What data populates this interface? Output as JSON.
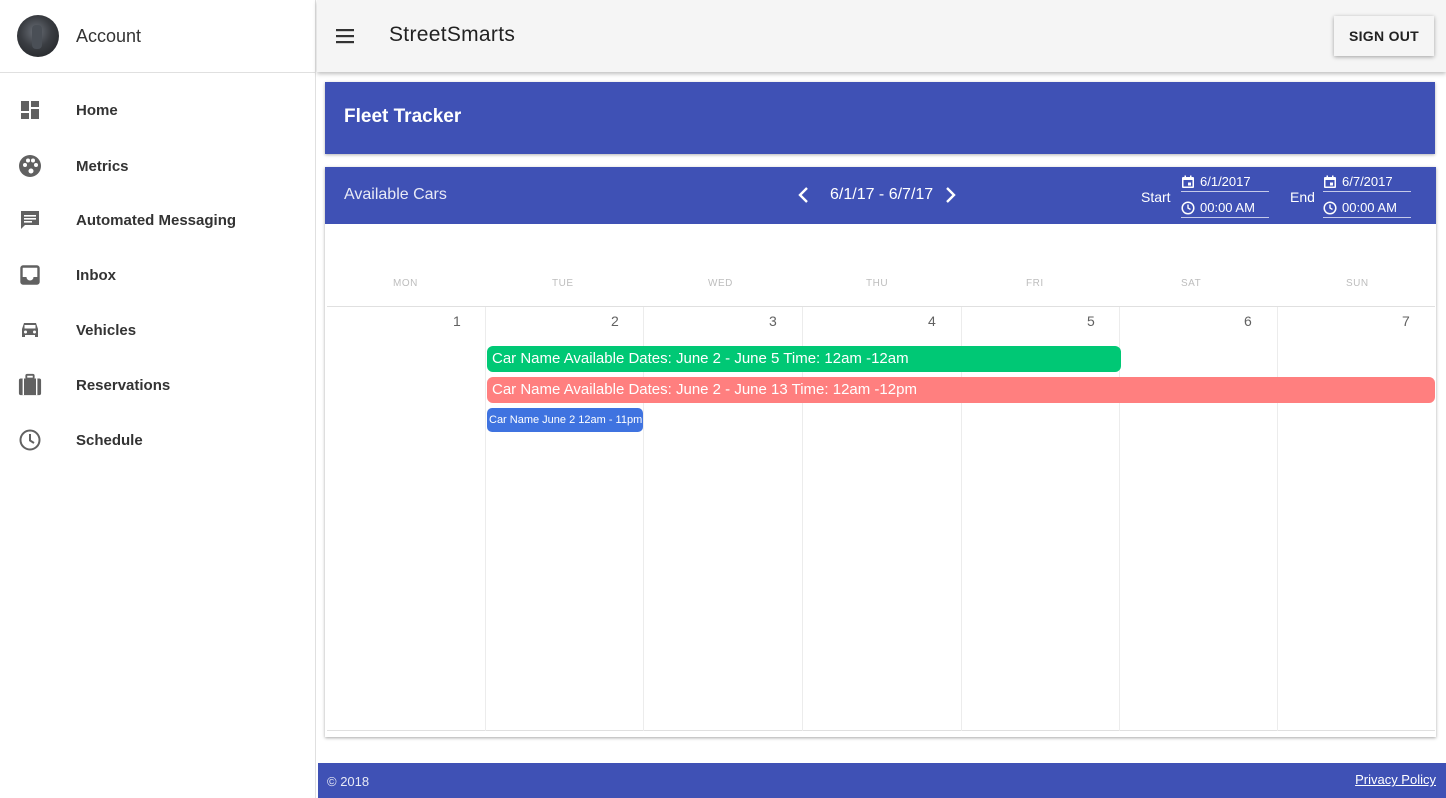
{
  "sidebar": {
    "account_label": "Account",
    "items": [
      {
        "label": "Home",
        "icon": "dashboard-icon"
      },
      {
        "label": "Metrics",
        "icon": "palette-icon"
      },
      {
        "label": "Automated Messaging",
        "icon": "chat-message-icon"
      },
      {
        "label": "Inbox",
        "icon": "inbox-icon"
      },
      {
        "label": "Vehicles",
        "icon": "car-icon"
      },
      {
        "label": "Reservations",
        "icon": "luggage-icon"
      },
      {
        "label": "Schedule",
        "icon": "clock-icon"
      }
    ]
  },
  "topbar": {
    "title": "StreetSmarts",
    "signout_label": "SIGN OUT",
    "menu_icon": "hamburger-menu-icon"
  },
  "fleet": {
    "title": "Fleet Tracker"
  },
  "calendar": {
    "title": "Available Cars",
    "range": "6/1/17 - 6/7/17",
    "start_label": "Start",
    "end_label": "End",
    "start_date": "6/1/2017",
    "start_time": "00:00 AM",
    "end_date": "6/7/2017",
    "end_time": "00:00 AM",
    "day_names": [
      "MON",
      "TUE",
      "WED",
      "THU",
      "FRI",
      "SAT",
      "SUN"
    ],
    "dates": [
      "1",
      "2",
      "3",
      "4",
      "5",
      "6",
      "7"
    ],
    "events": [
      {
        "label": "Car Name  Available Dates: June 2 - June 5  Time: 12am -12am",
        "color": "#00c875"
      },
      {
        "label": "Car Name  Available Dates: June 2 - June 13  Time: 12am -12pm",
        "color": "#ff7f7f"
      },
      {
        "label": "Car Name June 2 12am - 11pm",
        "color": "#3f73e0"
      }
    ]
  },
  "footer": {
    "copyright": "© 2018",
    "privacy": "Privacy Policy"
  },
  "colors": {
    "primary": "#3f51b5",
    "topbar_bg": "#f5f5f5"
  }
}
